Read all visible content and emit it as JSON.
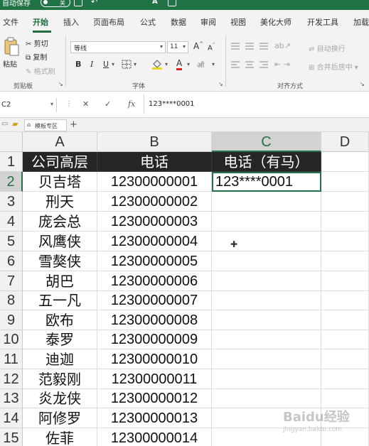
{
  "title_bar": {
    "autosave_label": "自动保存",
    "toggle_text": "关"
  },
  "ribbon_tabs": [
    "文件",
    "开始",
    "插入",
    "页面布局",
    "公式",
    "数据",
    "审阅",
    "视图",
    "美化大师",
    "开发工具",
    "加载项"
  ],
  "active_tab": "开始",
  "clipboard": {
    "paste_label": "粘贴",
    "cut_label": "剪切",
    "copy_label": "复制",
    "format_painter_label": "格式刷",
    "group_label": "剪贴板"
  },
  "font": {
    "name": "等线",
    "size": "11",
    "group_label": "字体",
    "bold": "B",
    "italic": "I",
    "underline": "U"
  },
  "alignment": {
    "wrap_label": "自动换行",
    "merge_label": "合并后居中",
    "group_label": "对齐方式"
  },
  "formula_bar": {
    "name_box": "C2",
    "fx_label": "fx",
    "content": "123****0001"
  },
  "workbook_tab": {
    "label": "模板专区"
  },
  "columns": [
    "A",
    "B",
    "C",
    "D"
  ],
  "rows": [
    "1",
    "2",
    "3",
    "4",
    "5",
    "6",
    "7",
    "8",
    "9",
    "10",
    "11",
    "12",
    "13",
    "14",
    "15"
  ],
  "sheet": {
    "headers": [
      "公司高层",
      "电话",
      "电话（有马）"
    ],
    "names": [
      "贝吉塔",
      "刑天",
      "庞会总",
      "风鹰侠",
      "雪獒侠",
      "胡巴",
      "五一凡",
      "欧布",
      "泰罗",
      "迪迦",
      "范毅刚",
      "炎龙侠",
      "阿修罗",
      "佐菲"
    ],
    "phones": [
      "12300000001",
      "12300000002",
      "12300000003",
      "12300000004",
      "12300000005",
      "12300000006",
      "12300000007",
      "12300000008",
      "12300000009",
      "12300000010",
      "12300000011",
      "12300000012",
      "12300000013",
      "12300000014"
    ],
    "masked": [
      "123****0001"
    ]
  },
  "colors": {
    "accent": "#217346",
    "header_fill": "#262626"
  },
  "watermark": {
    "logo": "Baidu经验",
    "sub": "jingyan.baidu.com"
  }
}
